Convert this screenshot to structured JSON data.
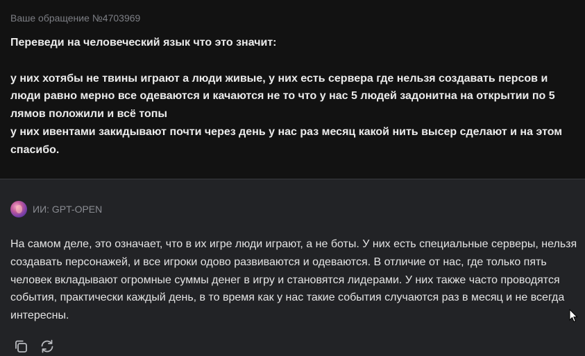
{
  "request": {
    "header": "Ваше обращение №4703969",
    "lines": [
      "Переведи на человеческий язык что это значит:",
      "у них хотябы не твины играют а люди живые, у них есть сервера где нельзя создавать персов и люди равно мерно все одеваются и качаются не то что у нас 5 людей задонитна на открытии по 5 лямов положили и всё топы",
      "у них ивентами закидывают почти через день у нас раз месяц какой нить высер сделают и на этом спасибо."
    ]
  },
  "answer": {
    "author": "ИИ: GPT-OPEN",
    "text": "На самом деле, это означает, что в их игре люди играют, а не боты. У них есть специальные серверы, нельзя создавать персонажей, и все игроки одово развиваются и одеваются. В отличие от нас, где только пять человек вкладывают огромные суммы денег в игру и становятся лидерами. У них также часто проводятся события, практически каждый день, в то время как у нас такие события случаются раз в месяц и не всегда интересны.",
    "actions": [
      {
        "icon": "copy-icon"
      },
      {
        "icon": "regenerate-icon"
      }
    ]
  }
}
